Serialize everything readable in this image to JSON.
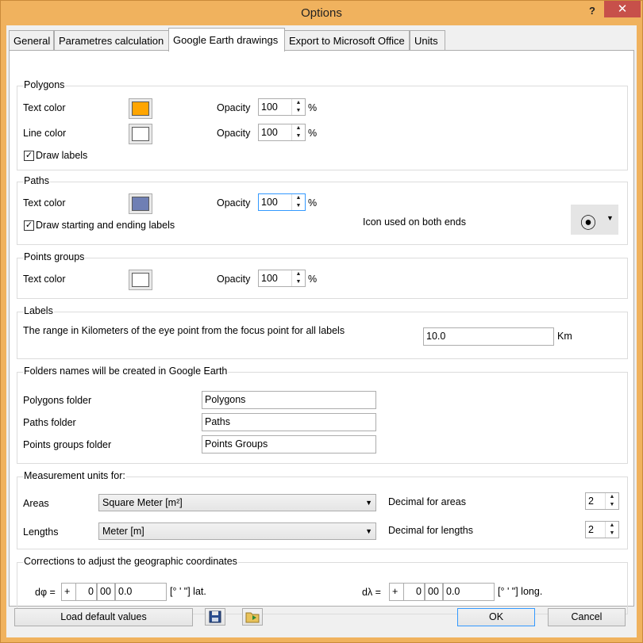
{
  "window": {
    "title": "Options",
    "help": "?",
    "close": "✕"
  },
  "tabs": [
    "General",
    "Parametres calculation",
    "Google Earth drawings",
    "Export to Microsoft Office",
    "Units"
  ],
  "polygons": {
    "legend": "Polygons",
    "text_color_label": "Text color",
    "text_color": "#ffa500",
    "line_color_label": "Line color",
    "line_color": "#ffffff",
    "opacity_label": "Opacity",
    "text_opacity": "100",
    "line_opacity": "100",
    "percent": "%",
    "draw_labels": "Draw labels",
    "draw_labels_checked": true
  },
  "paths": {
    "legend": "Paths",
    "text_color_label": "Text color",
    "text_color": "#6f7fb4",
    "opacity_label": "Opacity",
    "opacity": "100",
    "percent": "%",
    "draw_labels": "Draw starting and ending labels",
    "draw_labels_checked": true,
    "icon_label": "Icon used on both ends",
    "icon_symbol": "⦿"
  },
  "points_groups": {
    "legend": "Points groups",
    "text_color_label": "Text color",
    "text_color": "#ffffff",
    "opacity_label": "Opacity",
    "opacity": "100",
    "percent": "%"
  },
  "labels": {
    "legend": "Labels",
    "range_label": "The range in Kilometers of the eye point from the focus point for all labels",
    "range_value": "10.0",
    "unit": "Km"
  },
  "folders": {
    "legend": "Folders names will be created in Google Earth",
    "polygons_label": "Polygons folder",
    "polygons_value": "Polygons",
    "paths_label": "Paths folder",
    "paths_value": "Paths",
    "points_label": "Points groups folder",
    "points_value": "Points Groups"
  },
  "measurement": {
    "legend": "Measurement units for:",
    "areas_label": "Areas",
    "areas_value": "Square Meter [m²]",
    "lengths_label": "Lengths",
    "lengths_value": "Meter [m]",
    "dec_areas_label": "Decimal for areas",
    "dec_areas_value": "2",
    "dec_lengths_label": "Decimal for lengths",
    "dec_lengths_value": "2"
  },
  "corrections": {
    "legend": "Corrections to adjust the geographic coordinates",
    "lat_label": "dφ =",
    "lat_sign": "+",
    "lat_deg": "0",
    "lat_min": "00",
    "lat_sec": "0.0",
    "lat_unit": "[° ' \"] lat.",
    "lon_label": "dλ =",
    "lon_sign": "+",
    "lon_deg": "0",
    "lon_min": "00",
    "lon_sec": "0.0",
    "lon_unit": "[° ' \"] long."
  },
  "footer": {
    "load_defaults": "Load default values",
    "ok": "OK",
    "cancel": "Cancel"
  }
}
